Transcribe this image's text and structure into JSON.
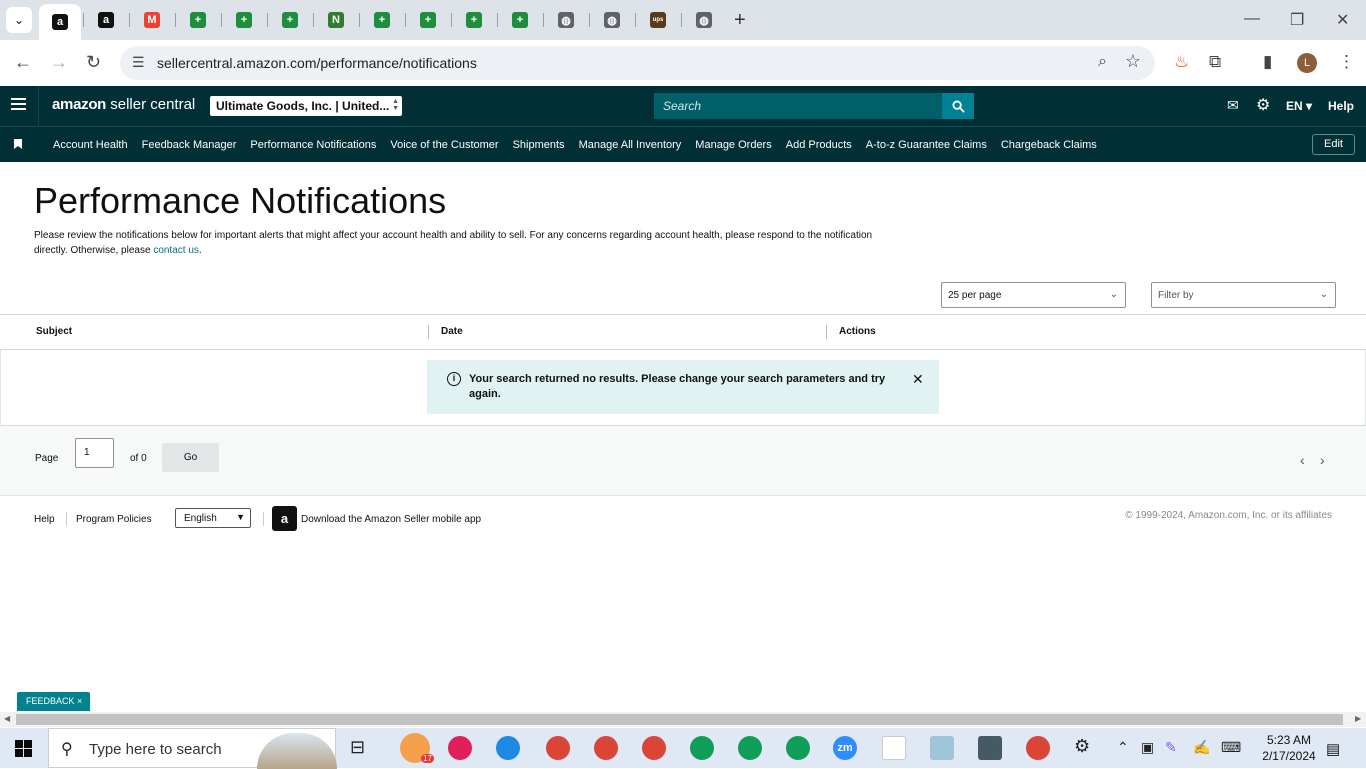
{
  "browser": {
    "url": "sellercentral.amazon.com/performance/notifications",
    "tabs": [
      {
        "name": "amazon",
        "color": "#111111",
        "glyph": "a"
      },
      {
        "name": "amazon",
        "color": "#111111",
        "glyph": "a"
      },
      {
        "name": "gmail",
        "color": "#ea4335",
        "glyph": "M"
      },
      {
        "name": "sheets",
        "color": "#1e8e3e",
        "glyph": "+"
      },
      {
        "name": "sheets",
        "color": "#1e8e3e",
        "glyph": "+"
      },
      {
        "name": "sheets",
        "color": "#1e8e3e",
        "glyph": "+"
      },
      {
        "name": "app-n",
        "color": "#2e7d32",
        "glyph": "N"
      },
      {
        "name": "sheets",
        "color": "#1e8e3e",
        "glyph": "+"
      },
      {
        "name": "sheets",
        "color": "#1e8e3e",
        "glyph": "+"
      },
      {
        "name": "sheets",
        "color": "#1e8e3e",
        "glyph": "+"
      },
      {
        "name": "sheets",
        "color": "#1e8e3e",
        "glyph": "+"
      },
      {
        "name": "globe",
        "color": "#5f6368",
        "glyph": "◍"
      },
      {
        "name": "globe",
        "color": "#5f6368",
        "glyph": "◍"
      },
      {
        "name": "ups",
        "color": "#5b3a1a",
        "glyph": "ups"
      },
      {
        "name": "globe",
        "color": "#5f6368",
        "glyph": "◍"
      }
    ],
    "profile_initial": "L"
  },
  "header": {
    "brand_bold": "amazon",
    "brand_rest": " seller central",
    "store": "Ultimate Goods, Inc. | United...",
    "search_placeholder": "Search",
    "language": "EN ▾",
    "help": "Help"
  },
  "nav": {
    "items": [
      "Account Health",
      "Feedback Manager",
      "Performance Notifications",
      "Voice of the Customer",
      "Shipments",
      "Manage All Inventory",
      "Manage Orders",
      "Add Products",
      "A-to-z Guarantee Claims",
      "Chargeback Claims"
    ],
    "edit": "Edit"
  },
  "main": {
    "title": "Performance Notifications",
    "description": "Please review the notifications below for important alerts that might affect your account health and ability to sell. For any concerns regarding account health, please respond to the notification directly. Otherwise, please ",
    "contact_link": "contact us",
    "description_end": ".",
    "per_page": "25 per page",
    "filter": "Filter by",
    "columns": [
      "Subject",
      "Date",
      "Actions"
    ],
    "alert": "Your search returned no results. Please change your search parameters and try again."
  },
  "pager": {
    "page_label": "Page",
    "page_value": "1",
    "of_label": "of 0",
    "go": "Go"
  },
  "footer": {
    "help": "Help",
    "policies": "Program Policies",
    "language": "English",
    "app_link": "Download the Amazon Seller mobile app",
    "copyright": "© 1999-2024, Amazon.com, Inc. or its affiliates"
  },
  "feedback": "FEEDBACK ×",
  "taskbar": {
    "search": "Type here to search",
    "time": "5:23 AM",
    "date": "2/17/2024",
    "badge": "17",
    "zoom": "zm"
  }
}
